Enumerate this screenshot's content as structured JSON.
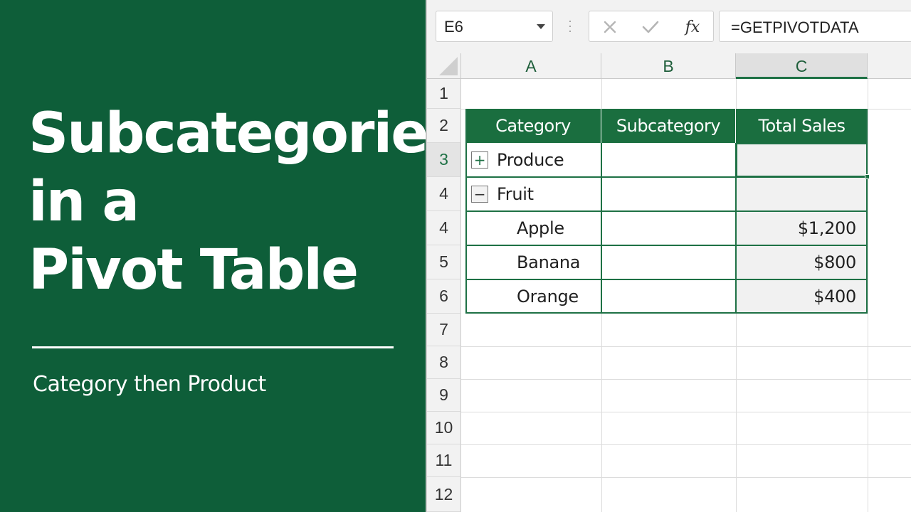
{
  "title": {
    "lines": [
      "Subcategories",
      "in a",
      "Pivot Table"
    ],
    "subtitle": "Category then Product"
  },
  "formula_bar": {
    "name_box": "E6",
    "cancel_icon": "close-icon",
    "enter_icon": "check-icon",
    "fx_label": "fx",
    "formula": "=GETPIVOTDATA"
  },
  "columns": [
    "A",
    "B",
    "C"
  ],
  "selected_column": "C",
  "row_numbers": [
    "1",
    "2",
    "3",
    "4",
    "4",
    "5",
    "6",
    "7",
    "8",
    "9",
    "10",
    "11",
    "12"
  ],
  "active_row": "3",
  "pivot": {
    "headers": [
      "Category",
      "Subcategory",
      "Total Sales"
    ],
    "rows": [
      {
        "toggle": "+",
        "label": "Produce",
        "subcategory": "",
        "total": ""
      },
      {
        "toggle": "−",
        "label": "Fruit",
        "subcategory": "",
        "total": ""
      },
      {
        "toggle": "",
        "label": "Apple",
        "subcategory": "",
        "total": "$1,200"
      },
      {
        "toggle": "",
        "label": "Banana",
        "subcategory": "",
        "total": "$800"
      },
      {
        "toggle": "",
        "label": "Orange",
        "subcategory": "",
        "total": "$400"
      }
    ]
  },
  "colors": {
    "panel": "#0e5e39",
    "header_fill": "#1a6e3f",
    "accent": "#1e7145"
  }
}
